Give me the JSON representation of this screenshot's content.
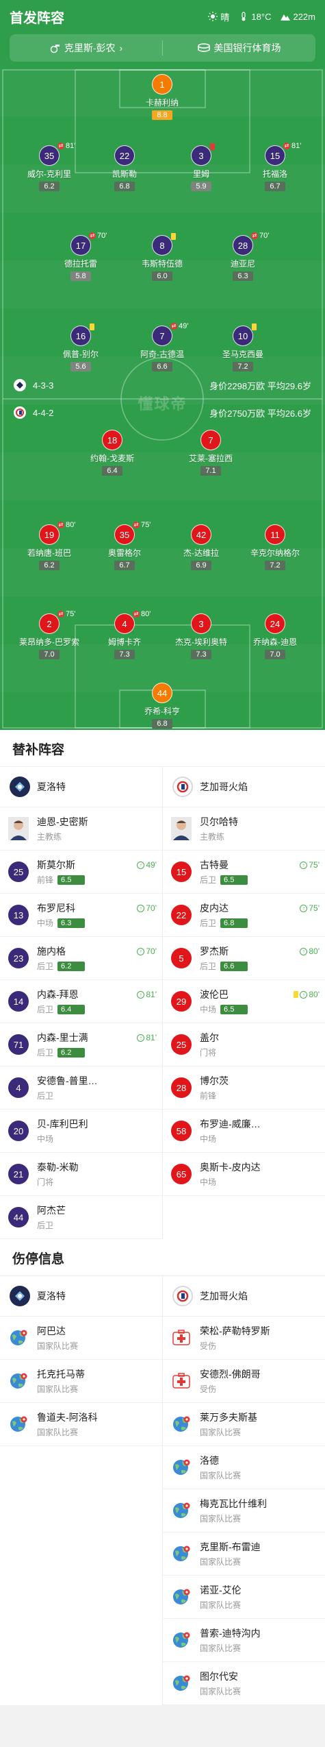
{
  "header": {
    "title": "首发阵容",
    "weather": "晴",
    "temperature": "18°C",
    "altitude": "222m"
  },
  "match_info": {
    "referee": "克里斯-彭农",
    "venue": "美国银行体育场"
  },
  "home": {
    "formation": "4-3-3",
    "value_text": "身价2298万欧 平均29.6岁",
    "players": [
      {
        "num": "1",
        "name": "卡赫利纳",
        "rating": "8.8",
        "gk": true
      },
      {
        "num": "35",
        "name": "威尔-克利里",
        "rating": "6.2",
        "sub": "81'"
      },
      {
        "num": "22",
        "name": "凯斯勒",
        "rating": "6.8"
      },
      {
        "num": "3",
        "name": "里姆",
        "rating": "5.9",
        "card": "red"
      },
      {
        "num": "15",
        "name": "托福洛",
        "rating": "6.7",
        "sub": "81'"
      },
      {
        "num": "17",
        "name": "德拉托雷",
        "rating": "5.8",
        "sub": "70'"
      },
      {
        "num": "8",
        "name": "韦斯特伍德",
        "rating": "6.0",
        "card": "yellow"
      },
      {
        "num": "28",
        "name": "迪亚尼",
        "rating": "6.3",
        "sub": "70'"
      },
      {
        "num": "16",
        "name": "佩普-别尔",
        "rating": "5.6",
        "card": "yellow"
      },
      {
        "num": "7",
        "name": "阿奇-古德温",
        "rating": "6.6",
        "sub": "49'"
      },
      {
        "num": "10",
        "name": "圣马克西曼",
        "rating": "7.2",
        "card": "yellow"
      }
    ]
  },
  "away": {
    "formation": "4-4-2",
    "value_text": "身价2750万欧 平均26.6岁",
    "players": [
      {
        "num": "18",
        "name": "约翰-戈麦斯",
        "rating": "6.4"
      },
      {
        "num": "7",
        "name": "艾莱-塞拉西",
        "rating": "7.1"
      },
      {
        "num": "19",
        "name": "若纳唐-班巴",
        "rating": "6.2",
        "sub": "80'"
      },
      {
        "num": "35",
        "name": "奥雷格尔",
        "rating": "6.7",
        "sub": "75'"
      },
      {
        "num": "42",
        "name": "杰-达维拉",
        "rating": "6.9"
      },
      {
        "num": "11",
        "name": "辛克尔纳格尔",
        "rating": "7.2"
      },
      {
        "num": "2",
        "name": "莱昂纳多-巴罗索",
        "rating": "7.0",
        "sub": "75'"
      },
      {
        "num": "4",
        "name": "姆博卡齐",
        "rating": "7.3",
        "sub": "80'"
      },
      {
        "num": "3",
        "name": "杰克-埃利奥特",
        "rating": "7.3"
      },
      {
        "num": "24",
        "name": "乔纳森-迪恩",
        "rating": "7.0"
      },
      {
        "num": "44",
        "name": "乔希-科亨",
        "rating": "6.8",
        "gk": true
      }
    ]
  },
  "subs": {
    "title": "替补阵容",
    "home_team": "夏洛特",
    "away_team": "芝加哥火焰",
    "home": [
      {
        "num": "",
        "name": "迪恩-史密斯",
        "pos": "主教练",
        "coach": true
      },
      {
        "num": "25",
        "name": "斯莫尔斯",
        "pos": "前锋",
        "rating": "6.5",
        "time": "49'"
      },
      {
        "num": "13",
        "name": "布罗尼科",
        "pos": "中场",
        "rating": "6.3",
        "time": "70'"
      },
      {
        "num": "23",
        "name": "施内格",
        "pos": "后卫",
        "rating": "6.2",
        "time": "70'"
      },
      {
        "num": "14",
        "name": "内森-拜恩",
        "pos": "后卫",
        "rating": "6.4",
        "time": "81'"
      },
      {
        "num": "71",
        "name": "内森-里士满",
        "pos": "后卫",
        "rating": "6.2",
        "time": "81'"
      },
      {
        "num": "4",
        "name": "安德鲁-普里…",
        "pos": "后卫"
      },
      {
        "num": "20",
        "name": "贝-库利巴利",
        "pos": "中场"
      },
      {
        "num": "21",
        "name": "泰勒-米勒",
        "pos": "门将"
      },
      {
        "num": "44",
        "name": "阿杰芒",
        "pos": "后卫"
      }
    ],
    "away": [
      {
        "num": "",
        "name": "贝尔哈特",
        "pos": "主教练",
        "coach": true
      },
      {
        "num": "15",
        "name": "古特曼",
        "pos": "后卫",
        "rating": "6.5",
        "time": "75'"
      },
      {
        "num": "22",
        "name": "皮内达",
        "pos": "后卫",
        "rating": "6.8",
        "time": "75'"
      },
      {
        "num": "5",
        "name": "罗杰斯",
        "pos": "后卫",
        "rating": "6.6",
        "time": "80'"
      },
      {
        "num": "29",
        "name": "波伦巴",
        "pos": "中场",
        "rating": "6.5",
        "time": "80'",
        "card": "yellow"
      },
      {
        "num": "25",
        "name": "盖尔",
        "pos": "门将"
      },
      {
        "num": "28",
        "name": "博尔茨",
        "pos": "前锋"
      },
      {
        "num": "58",
        "name": "布罗迪-威廉…",
        "pos": "中场"
      },
      {
        "num": "65",
        "name": "奥斯卡-皮内达",
        "pos": "中场"
      }
    ]
  },
  "injuries": {
    "title": "伤停信息",
    "home_team": "夏洛特",
    "away_team": "芝加哥火焰",
    "home": [
      {
        "name": "阿巴达",
        "status": "国家队比赛",
        "type": "national"
      },
      {
        "name": "托克托马蒂",
        "status": "国家队比赛",
        "type": "national"
      },
      {
        "name": "鲁道夫-阿洛科",
        "status": "国家队比赛",
        "type": "national"
      }
    ],
    "away": [
      {
        "name": "荣松-萨勒特罗斯",
        "status": "受伤",
        "type": "injury"
      },
      {
        "name": "安德烈-佛朗哥",
        "status": "受伤",
        "type": "injury"
      },
      {
        "name": "莱万多夫斯基",
        "status": "国家队比赛",
        "type": "national"
      },
      {
        "name": "洛德",
        "status": "国家队比赛",
        "type": "national"
      },
      {
        "name": "梅克瓦比什维利",
        "status": "国家队比赛",
        "type": "national"
      },
      {
        "name": "克里斯-布雷迪",
        "status": "国家队比赛",
        "type": "national"
      },
      {
        "name": "诺亚-艾伦",
        "status": "国家队比赛",
        "type": "national"
      },
      {
        "name": "普索-迪特沟内",
        "status": "国家队比赛",
        "type": "national"
      },
      {
        "name": "图尔代安",
        "status": "国家队比赛",
        "type": "national"
      }
    ]
  },
  "watermark": "懂球帝"
}
